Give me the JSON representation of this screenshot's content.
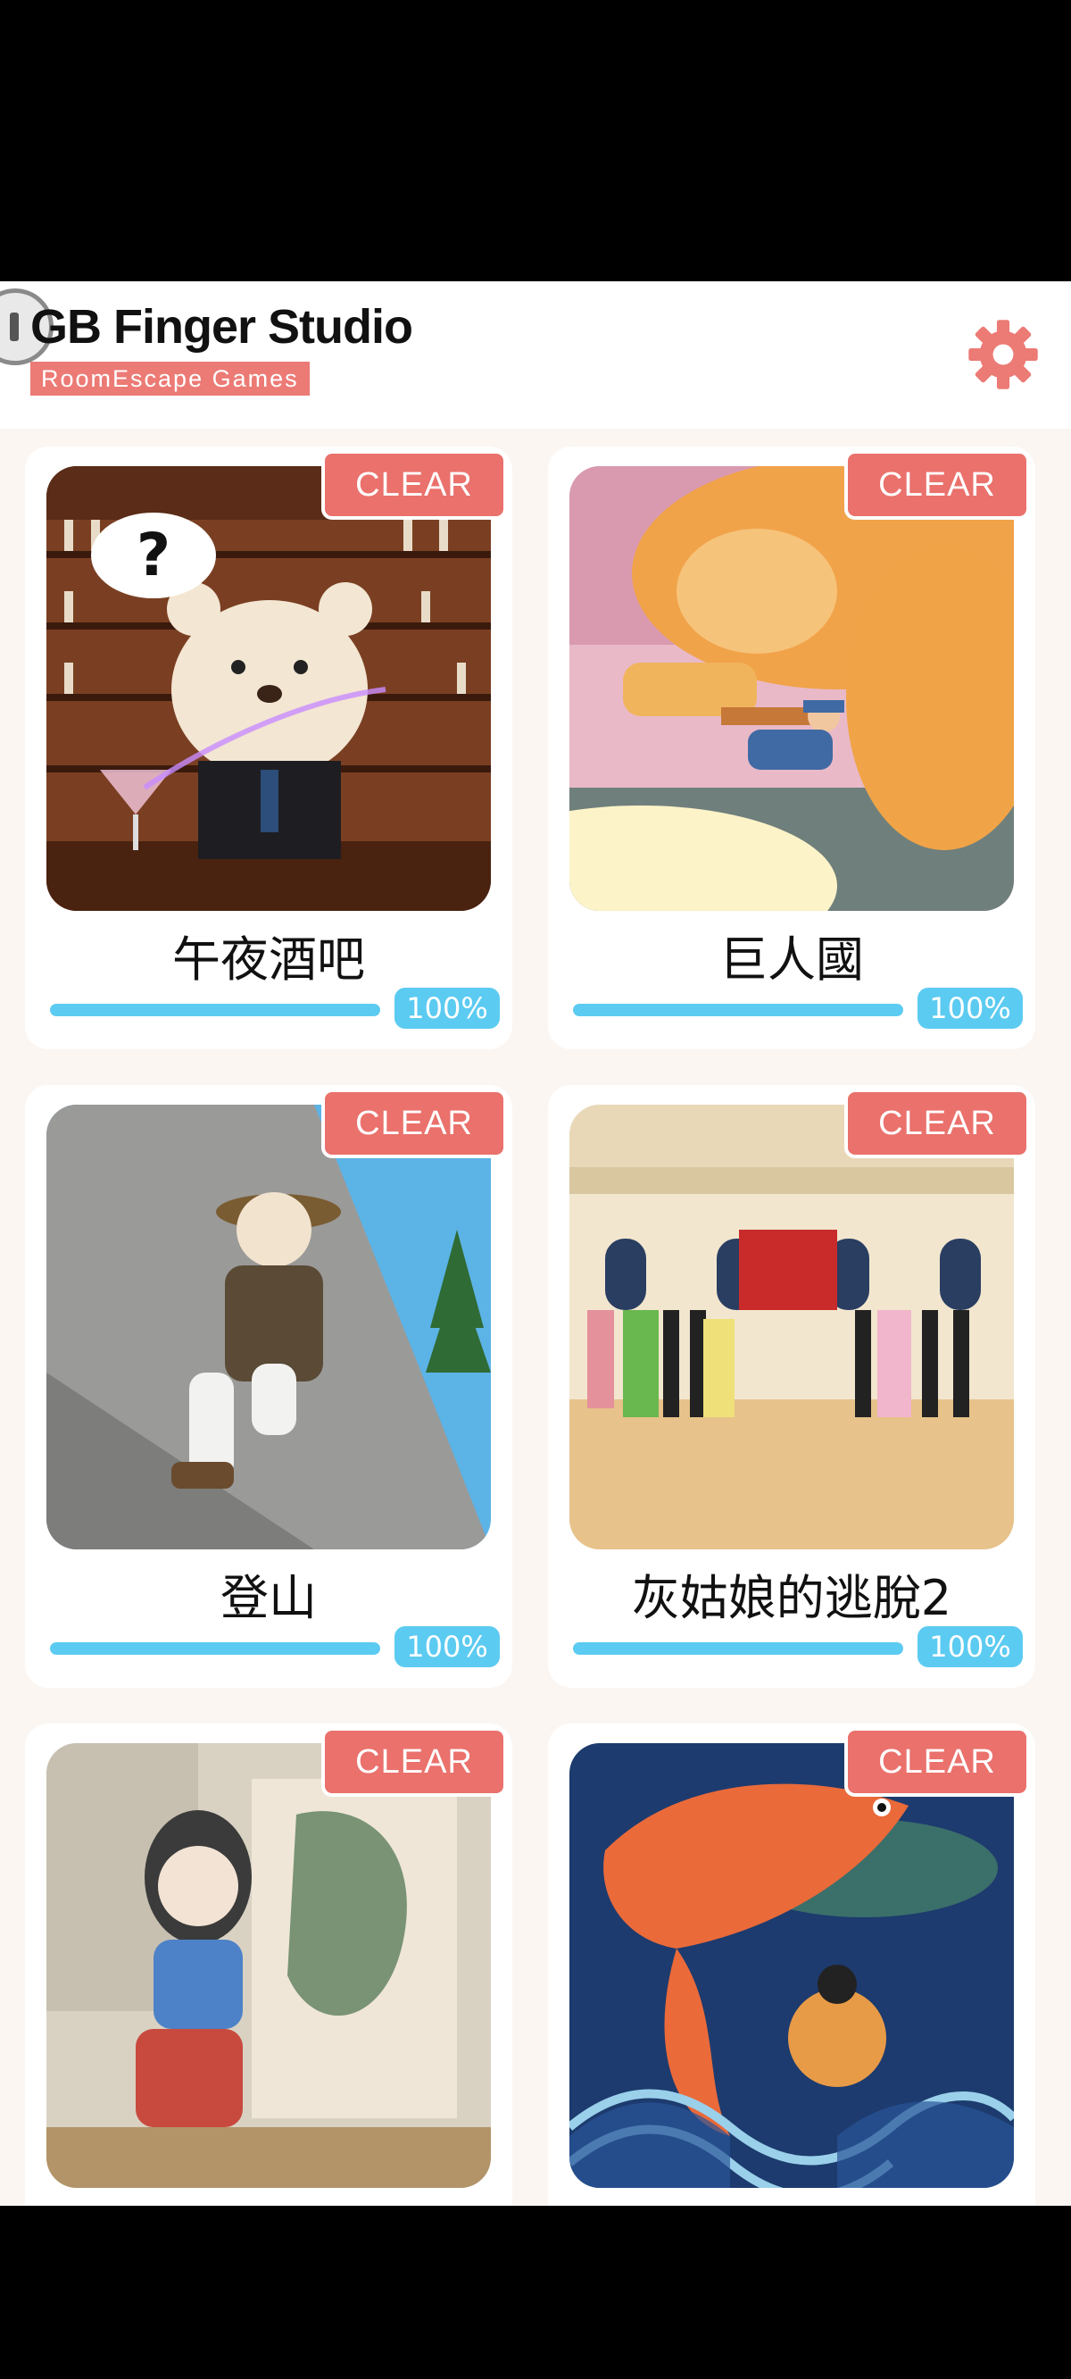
{
  "header": {
    "title": "GB Finger Studio",
    "subtitle": "RoomEscape Games"
  },
  "colors": {
    "accent": "#ec7a75",
    "progress": "#5ccbf1",
    "background": "#fbf6f2"
  },
  "games": [
    {
      "name": "午夜酒吧",
      "badge": "CLEAR",
      "progress": 1.0,
      "progress_label": "100%"
    },
    {
      "name": "巨人國",
      "badge": "CLEAR",
      "progress": 1.0,
      "progress_label": "100%"
    },
    {
      "name": "登山",
      "badge": "CLEAR",
      "progress": 1.0,
      "progress_label": "100%"
    },
    {
      "name": "灰姑娘的逃脫2",
      "badge": "CLEAR",
      "progress": 1.0,
      "progress_label": "100%"
    },
    {
      "name": "",
      "badge": "CLEAR",
      "progress": null,
      "progress_label": ""
    },
    {
      "name": "",
      "badge": "CLEAR",
      "progress": null,
      "progress_label": ""
    }
  ],
  "icons": {
    "settings": "gear-icon",
    "back": "back-circle-icon"
  }
}
